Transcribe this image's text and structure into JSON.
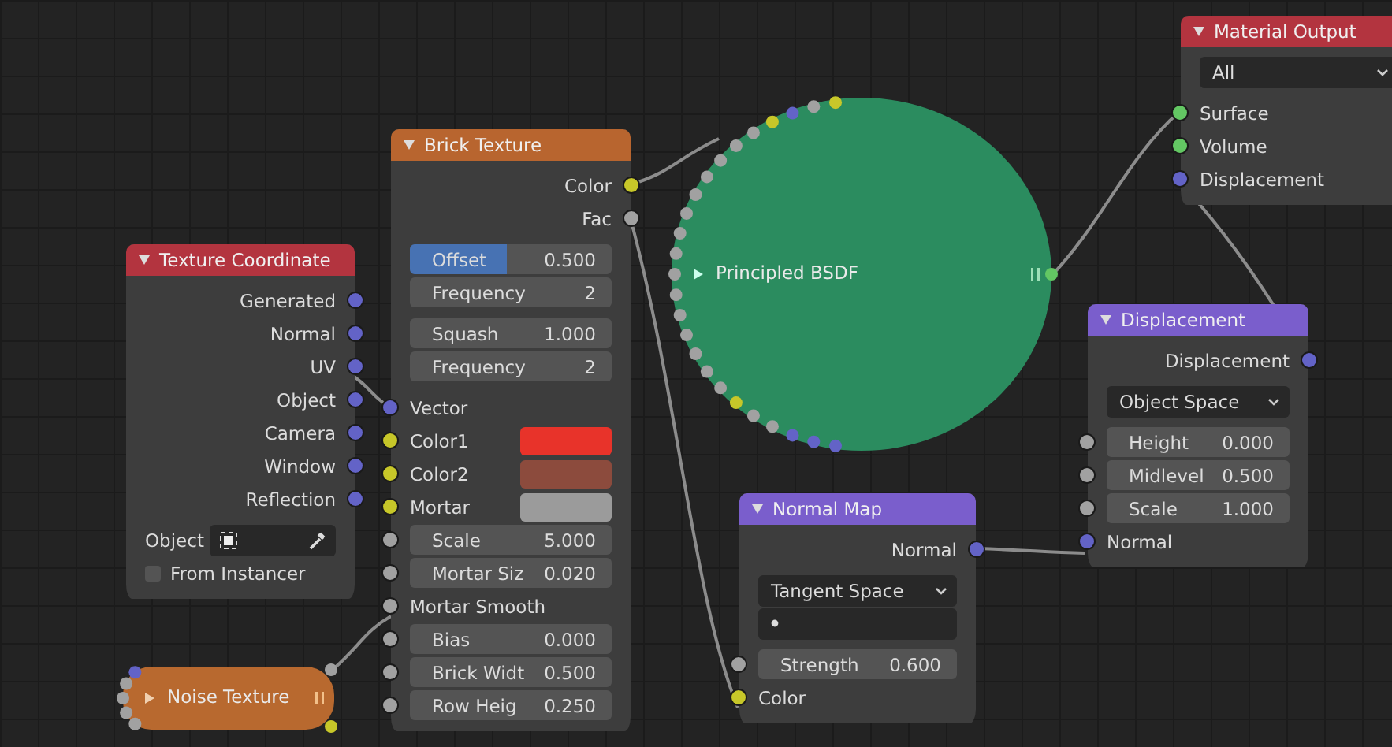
{
  "nodes": [
    {
      "kind": "node",
      "title": "Texture Coordinate",
      "color": "#b3343f",
      "sections": [
        [
          {
            "kind": "output",
            "label": "Generated",
            "socket": {
              "color": "#6363c7"
            }
          },
          {
            "kind": "output",
            "label": "Normal",
            "socket": {
              "color": "#6363c7"
            }
          },
          {
            "kind": "output",
            "label": "UV",
            "socket": {
              "color": "#6363c7"
            }
          },
          {
            "kind": "output",
            "label": "Object",
            "socket": {
              "color": "#6363c7"
            }
          },
          {
            "kind": "output",
            "label": "Camera",
            "socket": {
              "color": "#6363c7"
            }
          },
          {
            "kind": "output",
            "label": "Window",
            "socket": {
              "color": "#6363c7"
            }
          },
          {
            "kind": "output",
            "label": "Reflection",
            "socket": {
              "color": "#6363c7"
            }
          }
        ],
        [
          {
            "kind": "object_field",
            "label": "Object"
          },
          {
            "kind": "checkbox",
            "label": "From Instancer",
            "checked": false
          }
        ]
      ]
    },
    {
      "kind": "collapsed_pill",
      "title": "Noise Texture",
      "color": "#b8692f",
      "inputs": [
        {
          "color": "#6363c7"
        },
        {
          "color": "#a1a1a1"
        },
        {
          "color": "#a1a1a1"
        },
        {
          "color": "#a1a1a1"
        },
        {
          "color": "#a1a1a1"
        }
      ],
      "outputs": [
        {
          "color": "#a1a1a1"
        },
        {
          "color": "#c7c729"
        }
      ]
    },
    {
      "kind": "node",
      "title": "Brick Texture",
      "color": "#b8652f",
      "sections": [
        [
          {
            "kind": "output",
            "label": "Color",
            "socket": {
              "color": "#c7c729"
            }
          },
          {
            "kind": "output",
            "label": "Fac",
            "socket": {
              "color": "#a1a1a1"
            }
          }
        ],
        [
          {
            "kind": "field",
            "label": "Offset",
            "value": "0.500",
            "selected": true
          },
          {
            "kind": "field",
            "label": "Frequency",
            "value": "2",
            "selected": false
          }
        ],
        [
          {
            "kind": "field",
            "label": "Squash",
            "value": "1.000",
            "selected": false
          },
          {
            "kind": "field",
            "label": "Frequency",
            "value": "2",
            "selected": false
          }
        ],
        [
          {
            "kind": "input",
            "label": "Vector",
            "socket": {
              "color": "#6363c7"
            }
          },
          {
            "kind": "swatch",
            "label": "Color1",
            "socket": {
              "color": "#c7c729"
            },
            "color": "#e8332a"
          },
          {
            "kind": "swatch",
            "label": "Color2",
            "socket": {
              "color": "#c7c729"
            },
            "color": "#8c4b3d"
          },
          {
            "kind": "swatch",
            "label": "Mortar",
            "socket": {
              "color": "#c7c729"
            },
            "color": "#9b9b9b"
          },
          {
            "kind": "field",
            "label": "Scale",
            "value": "5.000",
            "socket": {
              "color": "#a1a1a1"
            },
            "selected": false
          },
          {
            "kind": "field",
            "label": "Mortar Siz",
            "value": "0.020",
            "socket": {
              "color": "#a1a1a1"
            },
            "selected": false
          },
          {
            "kind": "input",
            "label": "Mortar Smooth",
            "socket": {
              "color": "#a1a1a1"
            }
          },
          {
            "kind": "field",
            "label": "Bias",
            "value": "0.000",
            "socket": {
              "color": "#a1a1a1"
            },
            "selected": false
          },
          {
            "kind": "field",
            "label": "Brick Widt",
            "value": "0.500",
            "socket": {
              "color": "#a1a1a1"
            },
            "selected": false
          },
          {
            "kind": "field",
            "label": "Row Heig",
            "value": "0.250",
            "socket": {
              "color": "#a1a1a1"
            },
            "selected": false
          }
        ]
      ]
    },
    {
      "kind": "collapsed_circle",
      "title": "Principled BSDF",
      "color": "#2b8c5f",
      "inputs": [
        {
          "color": "#c7c729"
        },
        {
          "color": "#a1a1a1"
        },
        {
          "color": "#6363c7"
        },
        {
          "color": "#c7c729"
        },
        {
          "color": "#a1a1a1"
        },
        {
          "color": "#a1a1a1"
        },
        {
          "color": "#a1a1a1"
        },
        {
          "color": "#a1a1a1"
        },
        {
          "color": "#a1a1a1"
        },
        {
          "color": "#a1a1a1"
        },
        {
          "color": "#a1a1a1"
        },
        {
          "color": "#a1a1a1"
        },
        {
          "color": "#a1a1a1"
        },
        {
          "color": "#a1a1a1"
        },
        {
          "color": "#a1a1a1"
        },
        {
          "color": "#a1a1a1"
        },
        {
          "color": "#a1a1a1"
        },
        {
          "color": "#a1a1a1"
        },
        {
          "color": "#a1a1a1"
        },
        {
          "color": "#c7c729"
        },
        {
          "color": "#a1a1a1"
        },
        {
          "color": "#a1a1a1"
        },
        {
          "color": "#6363c7"
        },
        {
          "color": "#6363c7"
        },
        {
          "color": "#6363c7"
        }
      ],
      "outputs": [
        {
          "color": "#63c763"
        }
      ]
    },
    {
      "kind": "node",
      "title": "Normal Map",
      "color": "#7a5ecc",
      "sections": [
        [
          {
            "kind": "output",
            "label": "Normal",
            "socket": {
              "color": "#6363c7"
            }
          }
        ],
        [
          {
            "kind": "dropdown",
            "text": "Tangent Space"
          },
          {
            "kind": "uv_field"
          }
        ],
        [
          {
            "kind": "field",
            "label": "Strength",
            "value": "0.600",
            "socket": {
              "color": "#a1a1a1"
            },
            "selected": false
          },
          {
            "kind": "input",
            "label": "Color",
            "socket": {
              "color": "#c7c729"
            }
          }
        ]
      ]
    },
    {
      "kind": "node",
      "title": "Material Output",
      "color": "#b3343f",
      "sections": [
        [
          {
            "kind": "dropdown",
            "text": "All"
          }
        ],
        [
          {
            "kind": "input",
            "label": "Surface",
            "socket": {
              "color": "#63c763"
            }
          },
          {
            "kind": "input",
            "label": "Volume",
            "socket": {
              "color": "#63c763"
            }
          },
          {
            "kind": "input",
            "label": "Displacement",
            "socket": {
              "color": "#6363c7"
            }
          }
        ]
      ]
    },
    {
      "kind": "node",
      "title": "Displacement",
      "color": "#7a5ecc",
      "sections": [
        [
          {
            "kind": "output",
            "label": "Displacement",
            "socket": {
              "color": "#6363c7"
            }
          }
        ],
        [
          {
            "kind": "dropdown",
            "text": "Object Space"
          }
        ],
        [
          {
            "kind": "field",
            "label": "Height",
            "value": "0.000",
            "socket": {
              "color": "#a1a1a1"
            },
            "selected": false
          },
          {
            "kind": "field",
            "label": "Midlevel",
            "value": "0.500",
            "socket": {
              "color": "#a1a1a1"
            },
            "selected": false
          },
          {
            "kind": "field",
            "label": "Scale",
            "value": "1.000",
            "socket": {
              "color": "#a1a1a1"
            },
            "selected": false
          },
          {
            "kind": "input",
            "label": "Normal",
            "socket": {
              "color": "#6363c7"
            }
          }
        ]
      ]
    }
  ]
}
